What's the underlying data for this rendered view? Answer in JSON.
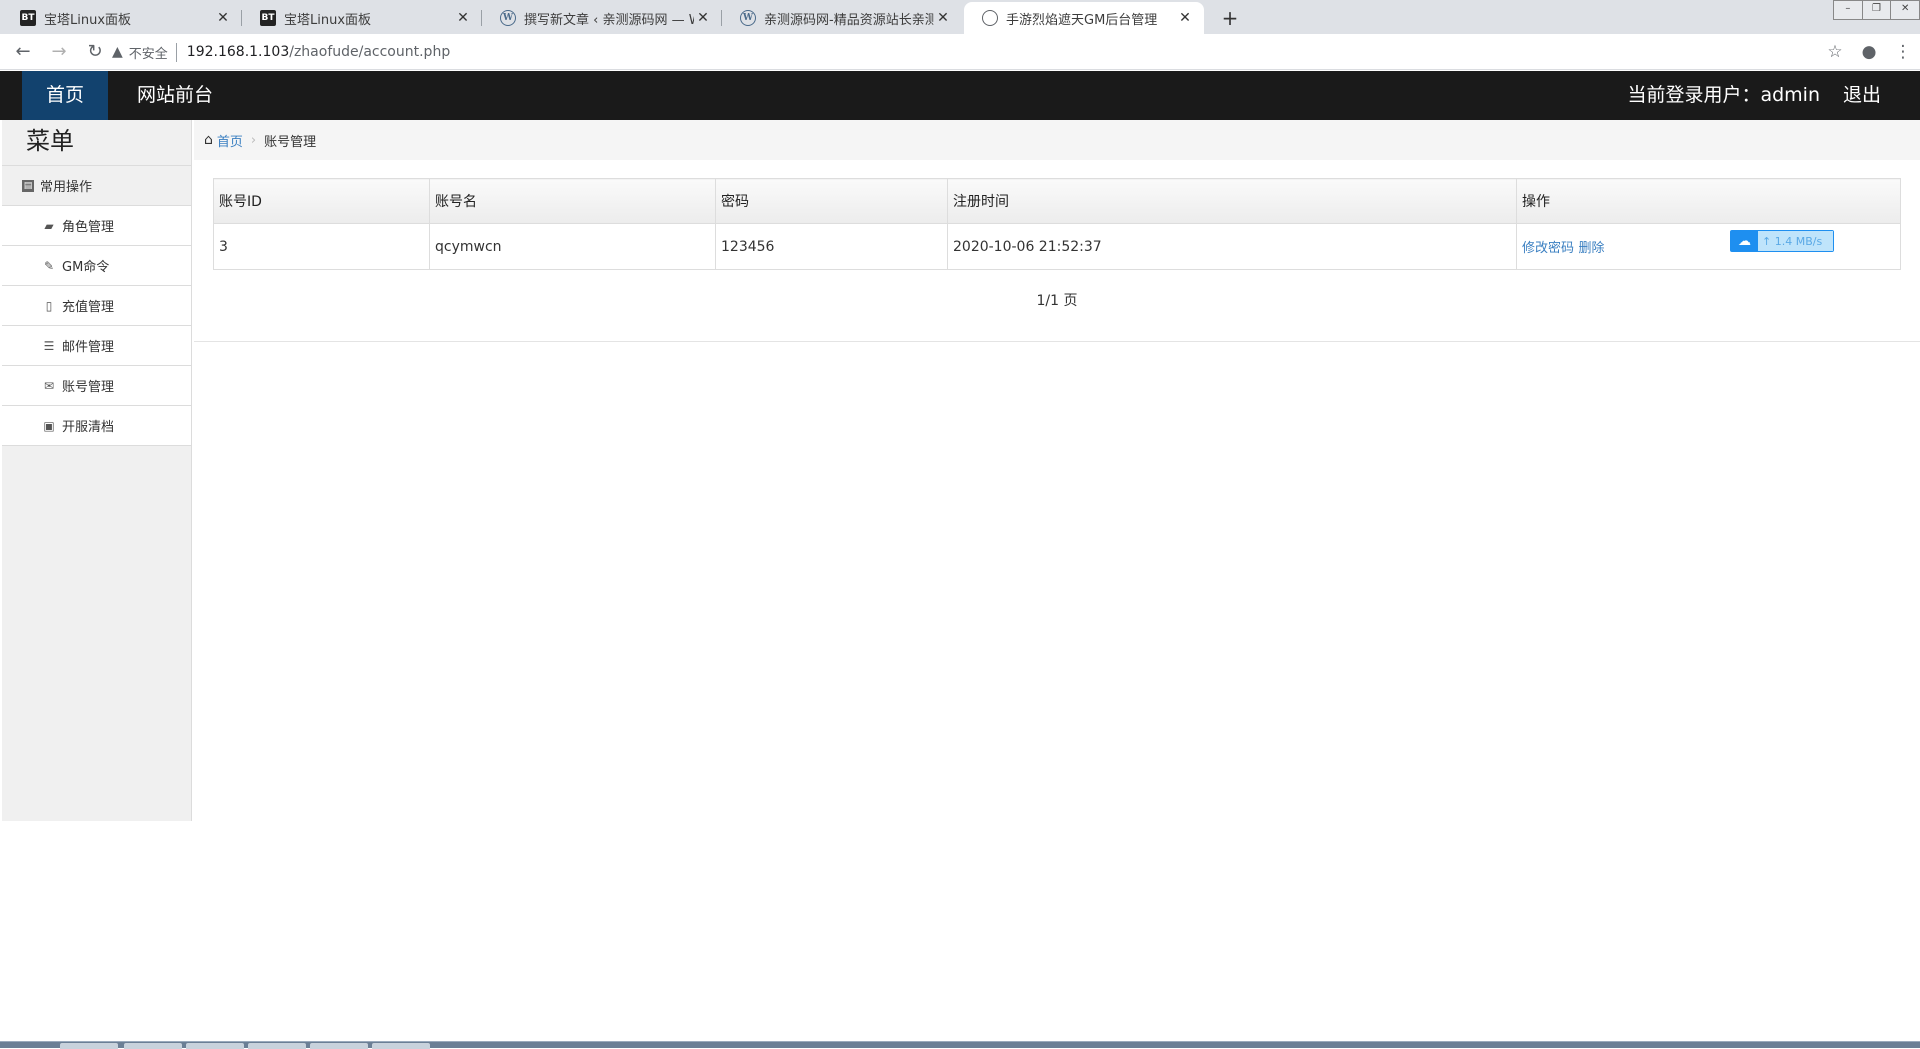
{
  "browser": {
    "tabs": [
      {
        "title": "宝塔Linux面板",
        "favicon": "BT",
        "active": false
      },
      {
        "title": "宝塔Linux面板",
        "favicon": "BT",
        "active": false
      },
      {
        "title": "撰写新文章 ‹ 亲测源码网 — Wor",
        "favicon": "W",
        "active": false
      },
      {
        "title": "亲测源码网-精品资源站长亲测",
        "favicon": "W",
        "active": false
      },
      {
        "title": "手游烈焰遮天GM后台管理",
        "favicon": "globe",
        "active": true
      }
    ],
    "new_tab": "+",
    "security_label": "不安全",
    "url_host": "192.168.1.103",
    "url_path": "/zhaofude/account.php"
  },
  "header": {
    "brand": "首页",
    "frontend_link": "网站前台",
    "user_label": "当前登录用户：admin",
    "logout": "退出"
  },
  "sidebar": {
    "title": "菜单",
    "group": "常用操作",
    "items": [
      {
        "label": "角色管理",
        "icon": "truck-icon"
      },
      {
        "label": "GM命令",
        "icon": "wrench-icon"
      },
      {
        "label": "充值管理",
        "icon": "file-icon"
      },
      {
        "label": "邮件管理",
        "icon": "list-icon"
      },
      {
        "label": "账号管理",
        "icon": "envelope-icon"
      },
      {
        "label": "开服清档",
        "icon": "picture-icon"
      }
    ]
  },
  "breadcrumb": {
    "home": "首页",
    "current": "账号管理"
  },
  "table": {
    "headers": [
      "账号ID",
      "账号名",
      "密码",
      "注册时间",
      "操作"
    ],
    "rows": [
      {
        "id": "3",
        "name": "qcymwcn",
        "password": "123456",
        "registered": "2020-10-06 21:52:37",
        "actions": [
          "修改密码",
          "删除"
        ]
      }
    ]
  },
  "speed_badge": "1.4 MB/s",
  "pager": "1/1 页"
}
